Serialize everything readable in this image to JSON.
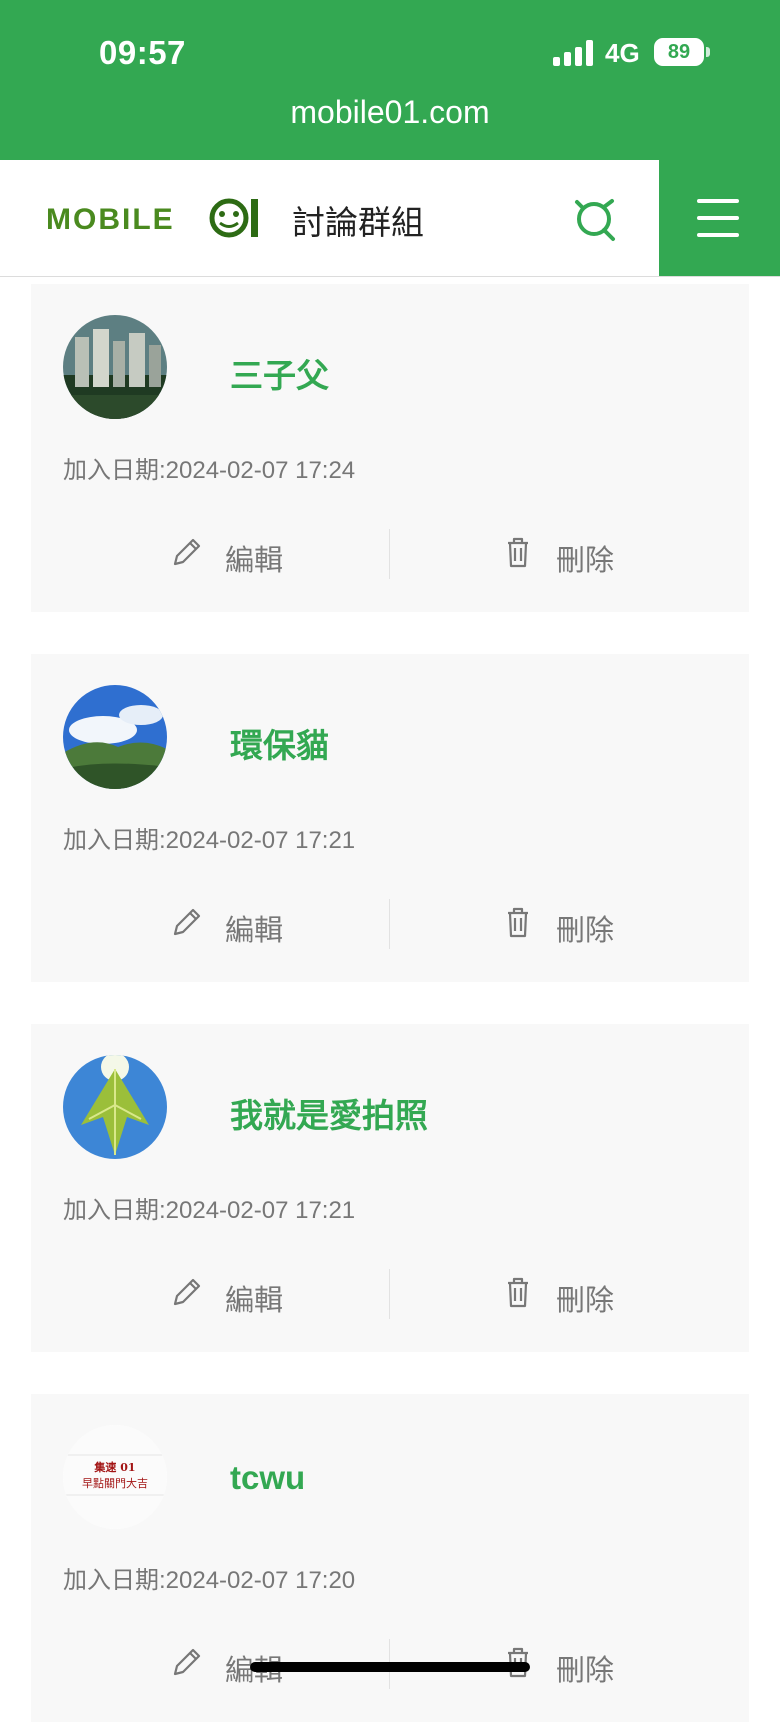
{
  "status_bar": {
    "time": "09:57",
    "network": "4G",
    "battery": "89"
  },
  "browser": {
    "url": "mobile01.com"
  },
  "header": {
    "logo_text": "MOBILE01",
    "site_title": "討論群組"
  },
  "actions": {
    "edit_label": "編輯",
    "delete_label": "刪除"
  },
  "members": [
    {
      "name": "三子父",
      "join_date": "加入日期:2024-02-07 17:24",
      "avatar": "city-skyline-avatar"
    },
    {
      "name": "環保貓",
      "join_date": "加入日期:2024-02-07 17:21",
      "avatar": "mountain-sky-avatar"
    },
    {
      "name": "我就是愛拍照",
      "join_date": "加入日期:2024-02-07 17:21",
      "avatar": "leaf-sunlight-avatar"
    },
    {
      "name": "tcwu",
      "join_date": "加入日期:2024-02-07 17:20",
      "avatar": "text-card-avatar",
      "avatar_text": [
        "集速 01",
        "早點關門大吉"
      ]
    }
  ],
  "colors": {
    "brand_green": "#33a852",
    "card_bg": "#f8f8f8",
    "muted_text": "#777777"
  }
}
